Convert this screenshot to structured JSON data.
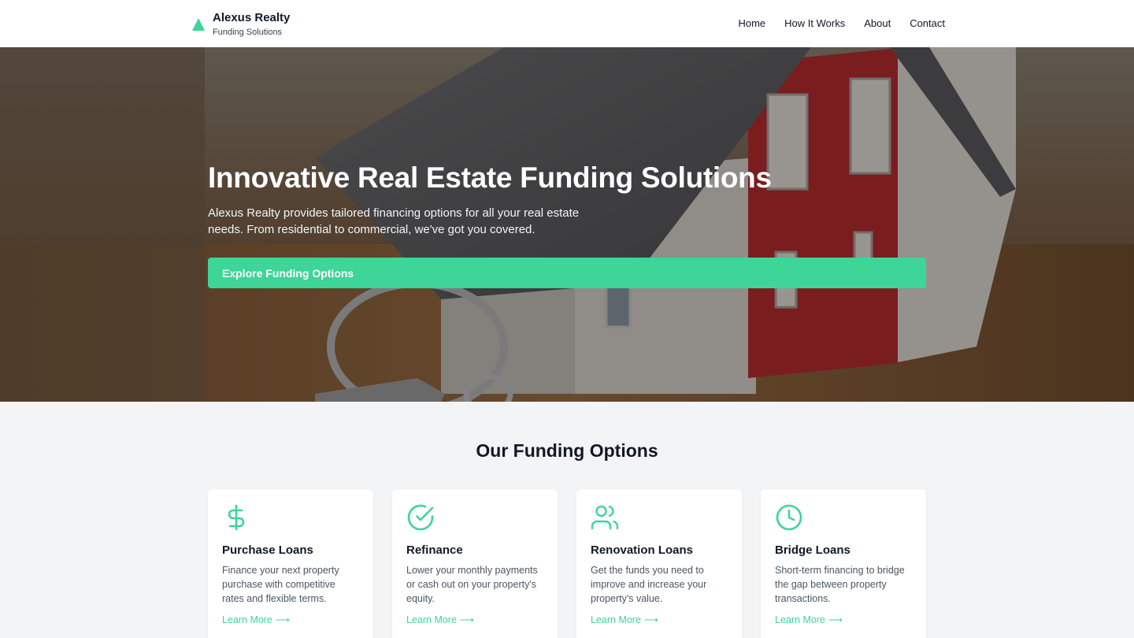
{
  "brand": {
    "name": "Alexus Realty",
    "tagline": "Funding Solutions"
  },
  "nav": {
    "items": [
      "Home",
      "How It Works",
      "About",
      "Contact"
    ]
  },
  "hero": {
    "title": "Innovative Real Estate Funding Solutions",
    "subtitle": "Alexus Realty provides tailored financing options for all your real estate needs. From residential to commercial, we've got you covered.",
    "cta": "Explore Funding Options"
  },
  "options": {
    "title": "Our Funding Options",
    "cards": [
      {
        "icon": "dollar-icon",
        "title": "Purchase Loans",
        "desc": "Finance your next property purchase with competitive rates and flexible terms.",
        "link": "Learn More"
      },
      {
        "icon": "check-circle-icon",
        "title": "Refinance",
        "desc": "Lower your monthly payments or cash out on your property's equity.",
        "link": "Learn More"
      },
      {
        "icon": "users-icon",
        "title": "Renovation Loans",
        "desc": "Get the funds you need to improve and increase your property's value.",
        "link": "Learn More"
      },
      {
        "icon": "clock-icon",
        "title": "Bridge Loans",
        "desc": "Short-term financing to bridge the gap between property transactions.",
        "link": "Learn More"
      }
    ]
  },
  "colors": {
    "accent": "#3dd598",
    "text": "#111827",
    "background": "#f3f4f6"
  }
}
